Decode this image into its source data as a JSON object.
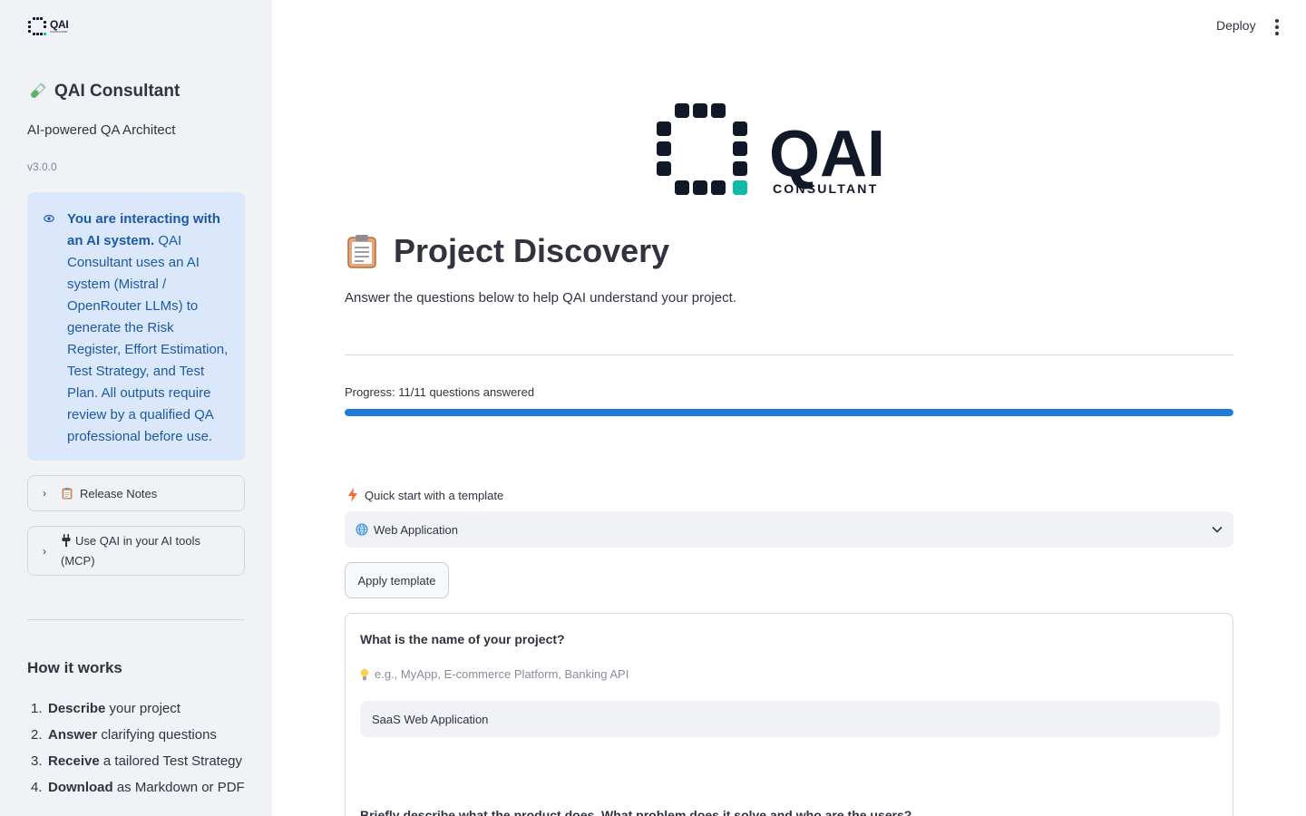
{
  "sidebar": {
    "logo_text": "QAI",
    "logo_sub": "CONSULTANT",
    "title": "QAI Consultant",
    "tagline": "AI-powered QA Architect",
    "version": "v3.0.0",
    "notice_bold": "You are interacting with an AI system.",
    "notice_text": " QAI Consultant uses an AI system (Mistral / OpenRouter LLMs) to generate the Risk Register, Effort Estimation, Test Strategy, and Test Plan. All outputs require review by a qualified QA professional before use.",
    "expanders": [
      {
        "label": "Release Notes"
      },
      {
        "label": "Use QAI in your AI tools (MCP)"
      }
    ],
    "how_title": "How it works",
    "how_steps": [
      {
        "num": "1.",
        "bold": "Describe",
        "rest": " your project"
      },
      {
        "num": "2.",
        "bold": "Answer",
        "rest": " clarifying questions"
      },
      {
        "num": "3.",
        "bold": "Receive",
        "rest": " a tailored Test Strategy"
      },
      {
        "num": "4.",
        "bold": "Download",
        "rest": " as Markdown or PDF"
      }
    ]
  },
  "header": {
    "deploy_label": "Deploy"
  },
  "main": {
    "logo_text": "QAI",
    "logo_sub": "CONSULTANT",
    "title": "Project Discovery",
    "subtitle": "Answer the questions below to help QAI understand your project.",
    "progress_label": "Progress: 11/11 questions answered",
    "progress_fraction": 1.0,
    "template_label": "Quick start with a template",
    "template_selected": "Web Application",
    "apply_label": "Apply template",
    "question1_label": "What is the name of your project?",
    "question1_hint": "e.g., MyApp, E-commerce Platform, Banking API",
    "question1_value": "SaaS Web Application",
    "question2_label": "Briefly describe what the product does. What problem does it solve and who are the users?"
  },
  "colors": {
    "accent": "#1e7bd8",
    "logo_teal": "#14b8a6",
    "logo_dark": "#111827",
    "info_bg": "#dbe7fb"
  }
}
